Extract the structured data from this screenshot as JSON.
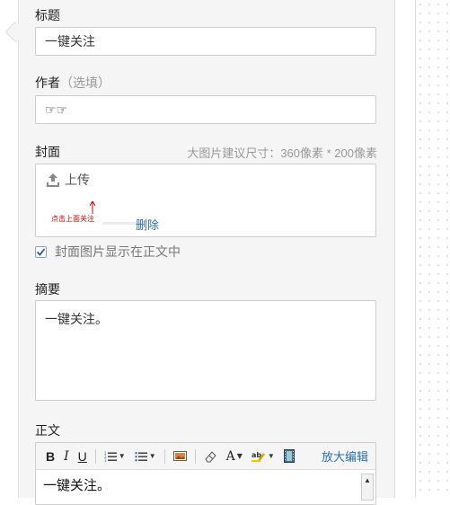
{
  "title_field": {
    "label": "标题",
    "value": "一键关注"
  },
  "author_field": {
    "label": "作者",
    "hint": "（选填）",
    "value": "☞☞"
  },
  "cover": {
    "label": "封面",
    "size_hint": "大图片建议尺寸：360像素 * 200像素",
    "upload_label": "上传",
    "thumbnail_text": "点击上面关注",
    "delete_label": "删除"
  },
  "show_cover_checkbox": {
    "label": "封面图片显示在正文中",
    "checked": true
  },
  "summary_field": {
    "label": "摘要",
    "value": "一键关注。"
  },
  "body_field": {
    "label": "正文",
    "toolbar": {
      "bold": "B",
      "italic": "I",
      "underline": "U",
      "font_color": "A",
      "expand_label": "放大编辑"
    },
    "content": "一键关注。"
  },
  "colors": {
    "link": "#2b6fb8",
    "panel_bg": "#f5f5f5",
    "thumb_text": "#cc0000"
  }
}
